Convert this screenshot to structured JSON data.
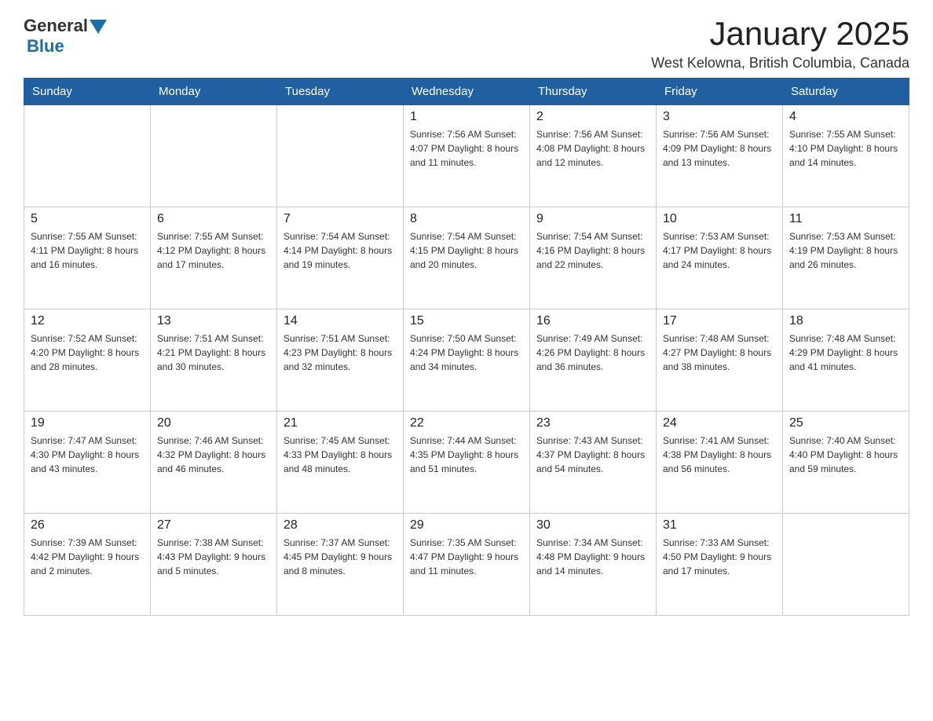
{
  "header": {
    "logo_general": "General",
    "logo_blue": "Blue",
    "month_title": "January 2025",
    "location": "West Kelowna, British Columbia, Canada"
  },
  "days_of_week": [
    "Sunday",
    "Monday",
    "Tuesday",
    "Wednesday",
    "Thursday",
    "Friday",
    "Saturday"
  ],
  "weeks": [
    [
      {
        "day": "",
        "info": ""
      },
      {
        "day": "",
        "info": ""
      },
      {
        "day": "",
        "info": ""
      },
      {
        "day": "1",
        "info": "Sunrise: 7:56 AM\nSunset: 4:07 PM\nDaylight: 8 hours\nand 11 minutes."
      },
      {
        "day": "2",
        "info": "Sunrise: 7:56 AM\nSunset: 4:08 PM\nDaylight: 8 hours\nand 12 minutes."
      },
      {
        "day": "3",
        "info": "Sunrise: 7:56 AM\nSunset: 4:09 PM\nDaylight: 8 hours\nand 13 minutes."
      },
      {
        "day": "4",
        "info": "Sunrise: 7:55 AM\nSunset: 4:10 PM\nDaylight: 8 hours\nand 14 minutes."
      }
    ],
    [
      {
        "day": "5",
        "info": "Sunrise: 7:55 AM\nSunset: 4:11 PM\nDaylight: 8 hours\nand 16 minutes."
      },
      {
        "day": "6",
        "info": "Sunrise: 7:55 AM\nSunset: 4:12 PM\nDaylight: 8 hours\nand 17 minutes."
      },
      {
        "day": "7",
        "info": "Sunrise: 7:54 AM\nSunset: 4:14 PM\nDaylight: 8 hours\nand 19 minutes."
      },
      {
        "day": "8",
        "info": "Sunrise: 7:54 AM\nSunset: 4:15 PM\nDaylight: 8 hours\nand 20 minutes."
      },
      {
        "day": "9",
        "info": "Sunrise: 7:54 AM\nSunset: 4:16 PM\nDaylight: 8 hours\nand 22 minutes."
      },
      {
        "day": "10",
        "info": "Sunrise: 7:53 AM\nSunset: 4:17 PM\nDaylight: 8 hours\nand 24 minutes."
      },
      {
        "day": "11",
        "info": "Sunrise: 7:53 AM\nSunset: 4:19 PM\nDaylight: 8 hours\nand 26 minutes."
      }
    ],
    [
      {
        "day": "12",
        "info": "Sunrise: 7:52 AM\nSunset: 4:20 PM\nDaylight: 8 hours\nand 28 minutes."
      },
      {
        "day": "13",
        "info": "Sunrise: 7:51 AM\nSunset: 4:21 PM\nDaylight: 8 hours\nand 30 minutes."
      },
      {
        "day": "14",
        "info": "Sunrise: 7:51 AM\nSunset: 4:23 PM\nDaylight: 8 hours\nand 32 minutes."
      },
      {
        "day": "15",
        "info": "Sunrise: 7:50 AM\nSunset: 4:24 PM\nDaylight: 8 hours\nand 34 minutes."
      },
      {
        "day": "16",
        "info": "Sunrise: 7:49 AM\nSunset: 4:26 PM\nDaylight: 8 hours\nand 36 minutes."
      },
      {
        "day": "17",
        "info": "Sunrise: 7:48 AM\nSunset: 4:27 PM\nDaylight: 8 hours\nand 38 minutes."
      },
      {
        "day": "18",
        "info": "Sunrise: 7:48 AM\nSunset: 4:29 PM\nDaylight: 8 hours\nand 41 minutes."
      }
    ],
    [
      {
        "day": "19",
        "info": "Sunrise: 7:47 AM\nSunset: 4:30 PM\nDaylight: 8 hours\nand 43 minutes."
      },
      {
        "day": "20",
        "info": "Sunrise: 7:46 AM\nSunset: 4:32 PM\nDaylight: 8 hours\nand 46 minutes."
      },
      {
        "day": "21",
        "info": "Sunrise: 7:45 AM\nSunset: 4:33 PM\nDaylight: 8 hours\nand 48 minutes."
      },
      {
        "day": "22",
        "info": "Sunrise: 7:44 AM\nSunset: 4:35 PM\nDaylight: 8 hours\nand 51 minutes."
      },
      {
        "day": "23",
        "info": "Sunrise: 7:43 AM\nSunset: 4:37 PM\nDaylight: 8 hours\nand 54 minutes."
      },
      {
        "day": "24",
        "info": "Sunrise: 7:41 AM\nSunset: 4:38 PM\nDaylight: 8 hours\nand 56 minutes."
      },
      {
        "day": "25",
        "info": "Sunrise: 7:40 AM\nSunset: 4:40 PM\nDaylight: 8 hours\nand 59 minutes."
      }
    ],
    [
      {
        "day": "26",
        "info": "Sunrise: 7:39 AM\nSunset: 4:42 PM\nDaylight: 9 hours\nand 2 minutes."
      },
      {
        "day": "27",
        "info": "Sunrise: 7:38 AM\nSunset: 4:43 PM\nDaylight: 9 hours\nand 5 minutes."
      },
      {
        "day": "28",
        "info": "Sunrise: 7:37 AM\nSunset: 4:45 PM\nDaylight: 9 hours\nand 8 minutes."
      },
      {
        "day": "29",
        "info": "Sunrise: 7:35 AM\nSunset: 4:47 PM\nDaylight: 9 hours\nand 11 minutes."
      },
      {
        "day": "30",
        "info": "Sunrise: 7:34 AM\nSunset: 4:48 PM\nDaylight: 9 hours\nand 14 minutes."
      },
      {
        "day": "31",
        "info": "Sunrise: 7:33 AM\nSunset: 4:50 PM\nDaylight: 9 hours\nand 17 minutes."
      },
      {
        "day": "",
        "info": ""
      }
    ]
  ]
}
